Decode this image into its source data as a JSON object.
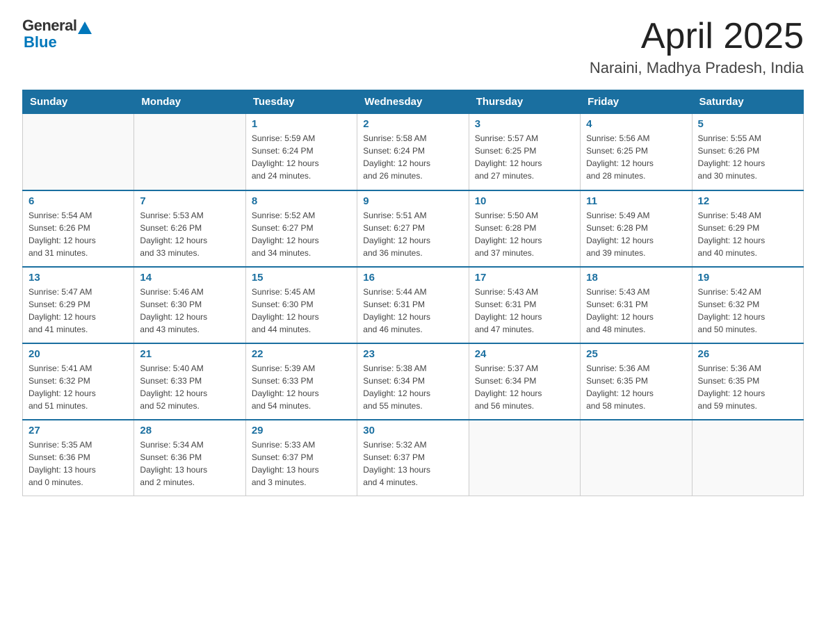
{
  "header": {
    "title": "April 2025",
    "subtitle": "Naraini, Madhya Pradesh, India",
    "logo_general": "General",
    "logo_blue": "Blue"
  },
  "days_of_week": [
    "Sunday",
    "Monday",
    "Tuesday",
    "Wednesday",
    "Thursday",
    "Friday",
    "Saturday"
  ],
  "weeks": [
    [
      {
        "day": "",
        "info": ""
      },
      {
        "day": "",
        "info": ""
      },
      {
        "day": "1",
        "info": "Sunrise: 5:59 AM\nSunset: 6:24 PM\nDaylight: 12 hours\nand 24 minutes."
      },
      {
        "day": "2",
        "info": "Sunrise: 5:58 AM\nSunset: 6:24 PM\nDaylight: 12 hours\nand 26 minutes."
      },
      {
        "day": "3",
        "info": "Sunrise: 5:57 AM\nSunset: 6:25 PM\nDaylight: 12 hours\nand 27 minutes."
      },
      {
        "day": "4",
        "info": "Sunrise: 5:56 AM\nSunset: 6:25 PM\nDaylight: 12 hours\nand 28 minutes."
      },
      {
        "day": "5",
        "info": "Sunrise: 5:55 AM\nSunset: 6:26 PM\nDaylight: 12 hours\nand 30 minutes."
      }
    ],
    [
      {
        "day": "6",
        "info": "Sunrise: 5:54 AM\nSunset: 6:26 PM\nDaylight: 12 hours\nand 31 minutes."
      },
      {
        "day": "7",
        "info": "Sunrise: 5:53 AM\nSunset: 6:26 PM\nDaylight: 12 hours\nand 33 minutes."
      },
      {
        "day": "8",
        "info": "Sunrise: 5:52 AM\nSunset: 6:27 PM\nDaylight: 12 hours\nand 34 minutes."
      },
      {
        "day": "9",
        "info": "Sunrise: 5:51 AM\nSunset: 6:27 PM\nDaylight: 12 hours\nand 36 minutes."
      },
      {
        "day": "10",
        "info": "Sunrise: 5:50 AM\nSunset: 6:28 PM\nDaylight: 12 hours\nand 37 minutes."
      },
      {
        "day": "11",
        "info": "Sunrise: 5:49 AM\nSunset: 6:28 PM\nDaylight: 12 hours\nand 39 minutes."
      },
      {
        "day": "12",
        "info": "Sunrise: 5:48 AM\nSunset: 6:29 PM\nDaylight: 12 hours\nand 40 minutes."
      }
    ],
    [
      {
        "day": "13",
        "info": "Sunrise: 5:47 AM\nSunset: 6:29 PM\nDaylight: 12 hours\nand 41 minutes."
      },
      {
        "day": "14",
        "info": "Sunrise: 5:46 AM\nSunset: 6:30 PM\nDaylight: 12 hours\nand 43 minutes."
      },
      {
        "day": "15",
        "info": "Sunrise: 5:45 AM\nSunset: 6:30 PM\nDaylight: 12 hours\nand 44 minutes."
      },
      {
        "day": "16",
        "info": "Sunrise: 5:44 AM\nSunset: 6:31 PM\nDaylight: 12 hours\nand 46 minutes."
      },
      {
        "day": "17",
        "info": "Sunrise: 5:43 AM\nSunset: 6:31 PM\nDaylight: 12 hours\nand 47 minutes."
      },
      {
        "day": "18",
        "info": "Sunrise: 5:43 AM\nSunset: 6:31 PM\nDaylight: 12 hours\nand 48 minutes."
      },
      {
        "day": "19",
        "info": "Sunrise: 5:42 AM\nSunset: 6:32 PM\nDaylight: 12 hours\nand 50 minutes."
      }
    ],
    [
      {
        "day": "20",
        "info": "Sunrise: 5:41 AM\nSunset: 6:32 PM\nDaylight: 12 hours\nand 51 minutes."
      },
      {
        "day": "21",
        "info": "Sunrise: 5:40 AM\nSunset: 6:33 PM\nDaylight: 12 hours\nand 52 minutes."
      },
      {
        "day": "22",
        "info": "Sunrise: 5:39 AM\nSunset: 6:33 PM\nDaylight: 12 hours\nand 54 minutes."
      },
      {
        "day": "23",
        "info": "Sunrise: 5:38 AM\nSunset: 6:34 PM\nDaylight: 12 hours\nand 55 minutes."
      },
      {
        "day": "24",
        "info": "Sunrise: 5:37 AM\nSunset: 6:34 PM\nDaylight: 12 hours\nand 56 minutes."
      },
      {
        "day": "25",
        "info": "Sunrise: 5:36 AM\nSunset: 6:35 PM\nDaylight: 12 hours\nand 58 minutes."
      },
      {
        "day": "26",
        "info": "Sunrise: 5:36 AM\nSunset: 6:35 PM\nDaylight: 12 hours\nand 59 minutes."
      }
    ],
    [
      {
        "day": "27",
        "info": "Sunrise: 5:35 AM\nSunset: 6:36 PM\nDaylight: 13 hours\nand 0 minutes."
      },
      {
        "day": "28",
        "info": "Sunrise: 5:34 AM\nSunset: 6:36 PM\nDaylight: 13 hours\nand 2 minutes."
      },
      {
        "day": "29",
        "info": "Sunrise: 5:33 AM\nSunset: 6:37 PM\nDaylight: 13 hours\nand 3 minutes."
      },
      {
        "day": "30",
        "info": "Sunrise: 5:32 AM\nSunset: 6:37 PM\nDaylight: 13 hours\nand 4 minutes."
      },
      {
        "day": "",
        "info": ""
      },
      {
        "day": "",
        "info": ""
      },
      {
        "day": "",
        "info": ""
      }
    ]
  ]
}
